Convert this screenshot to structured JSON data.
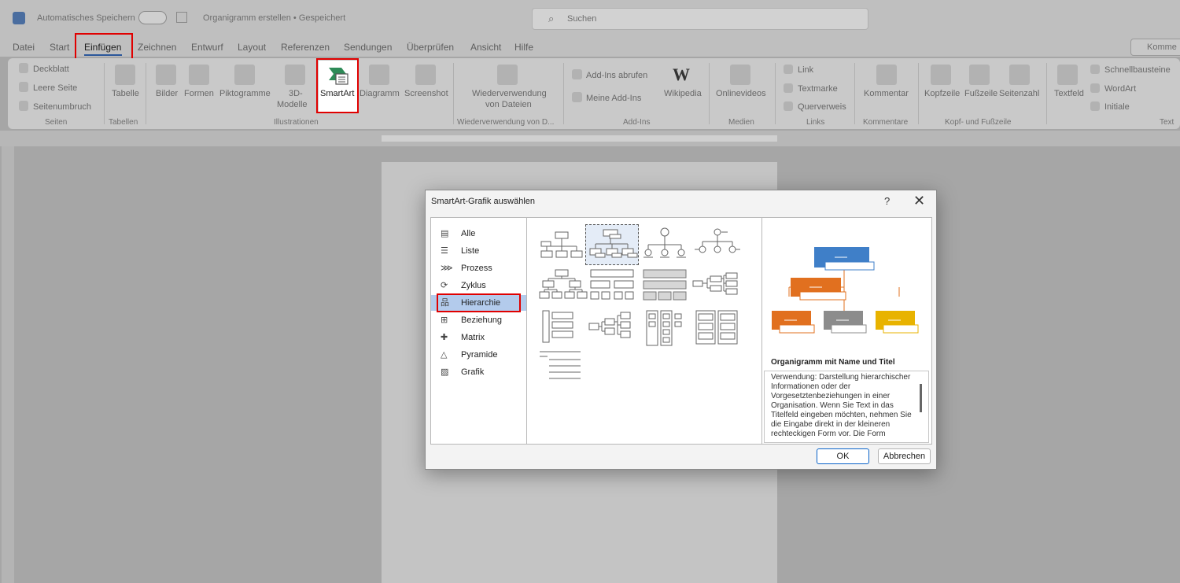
{
  "titlebar": {
    "autosave": "Automatisches Speichern",
    "doc_title": "Organigramm erstellen • Gespeichert",
    "search": "Suchen"
  },
  "tabs": [
    "Datei",
    "Start",
    "Einfügen",
    "Zeichnen",
    "Entwurf",
    "Layout",
    "Referenzen",
    "Sendungen",
    "Überprüfen",
    "Ansicht",
    "Hilfe"
  ],
  "comment_button": "Komme",
  "ribbon": {
    "deckblatt": "Deckblatt",
    "leere_seite": "Leere Seite",
    "seitenumbruch": "Seitenumbruch",
    "tabelle": "Tabelle",
    "bilder": "Bilder",
    "formen": "Formen",
    "piktogramme": "Piktogramme",
    "modelle_3d_1": "3D-",
    "modelle_3d_2": "Modelle",
    "smartart": "SmartArt",
    "diagramm": "Diagramm",
    "screenshot": "Screenshot",
    "wiederverwendung_1": "Wiederverwendung",
    "wiederverwendung_2": "von Dateien",
    "addins_abrufen": "Add-Ins abrufen",
    "meine_addins": "Meine Add-Ins",
    "wikipedia": "Wikipedia",
    "onlinevideos": "Onlinevideos",
    "link": "Link",
    "textmarke": "Textmarke",
    "querverweis": "Querverweis",
    "kommentar": "Kommentar",
    "kopfzeile": "Kopfzeile",
    "fusszeile": "Fußzeile",
    "seitenzahl": "Seitenzahl",
    "textfeld": "Textfeld",
    "schnellbausteine": "Schnellbausteine",
    "wordart": "WordArt",
    "initiale": "Initiale",
    "groups": {
      "seiten": "Seiten",
      "tabellen": "Tabellen",
      "illustrationen": "Illustrationen",
      "wiederverwendung": "Wiederverwendung von D...",
      "addins": "Add-Ins",
      "medien": "Medien",
      "links": "Links",
      "kommentare": "Kommentare",
      "kopf_fuss": "Kopf- und Fußzeile",
      "text": "Text"
    }
  },
  "dialog": {
    "title": "SmartArt-Grafik auswählen",
    "help": "?",
    "close": "✕",
    "categories": [
      "Alle",
      "Liste",
      "Prozess",
      "Zyklus",
      "Hierarchie",
      "Beziehung",
      "Matrix",
      "Pyramide",
      "Grafik"
    ],
    "selected_category": "Hierarchie",
    "preview_title": "Organigramm mit Name und Titel",
    "preview_desc": "Verwendung: Darstellung hierarchischer Informationen oder der Vorgesetztenbeziehungen in einer Organisation. Wenn Sie Text in das Titelfeld eingeben möchten, nehmen Sie die Eingabe direkt in der kleineren rechteckigen Form vor. Die Form",
    "ok": "OK",
    "cancel": "Abbrechen",
    "colors": {
      "blue": "#3f7fc8",
      "orange": "#e1701f",
      "gray": "#8c8c8c",
      "gold": "#e8b300",
      "selected": "#b3cbec"
    }
  }
}
